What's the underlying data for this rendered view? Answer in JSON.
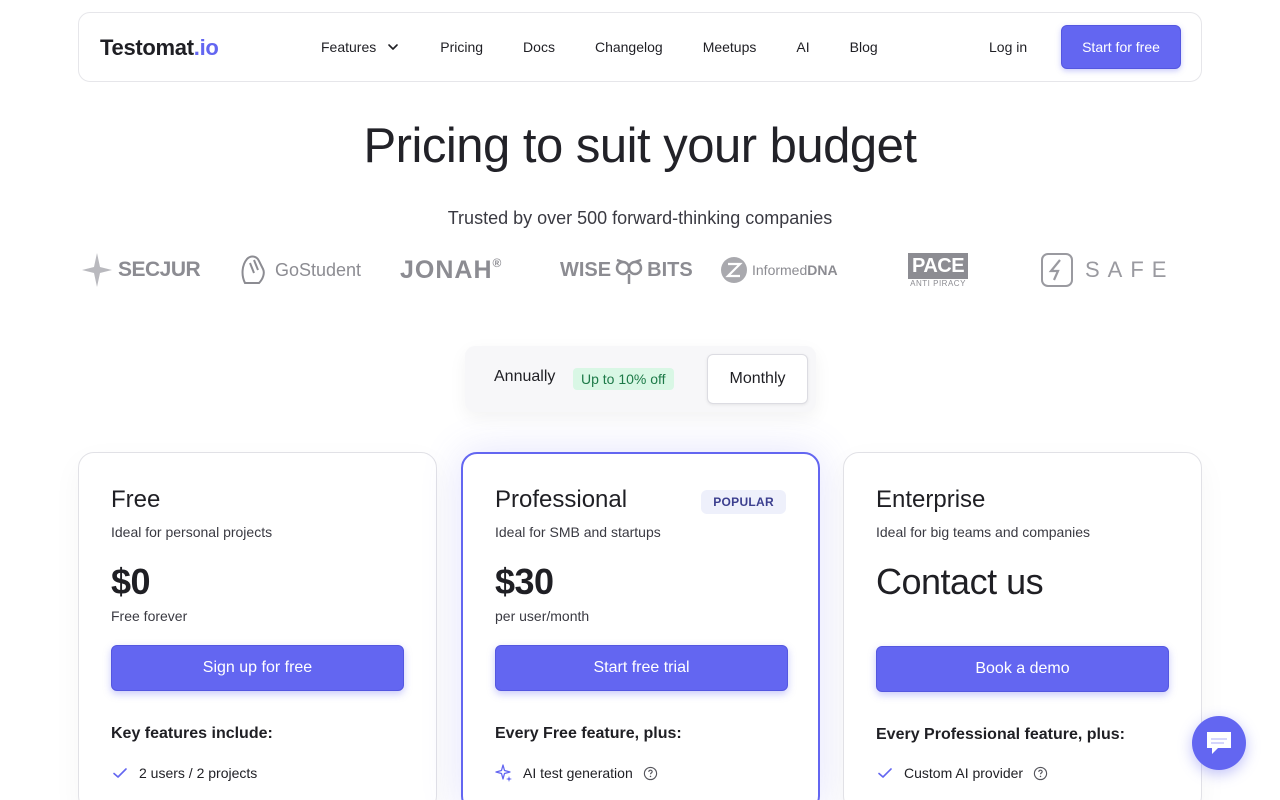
{
  "nav": {
    "logo_main": "Testomat",
    "logo_tld": ".io",
    "links": [
      {
        "label": "Features"
      },
      {
        "label": "Pricing"
      },
      {
        "label": "Docs"
      },
      {
        "label": "Changelog"
      },
      {
        "label": "Meetups"
      },
      {
        "label": "AI"
      },
      {
        "label": "Blog"
      }
    ],
    "login": "Log in",
    "cta": "Start for free"
  },
  "hero": {
    "title": "Pricing to suit your budget",
    "trusted": "Trusted by over 500 forward-thinking companies"
  },
  "brands": {
    "secjur": "SECJUR",
    "gostudent": "GoStudent",
    "jonah": "JONAH",
    "jonah_mark": "®",
    "wise": "WISE",
    "bits": "BITS",
    "informed": "Informed",
    "dna": "DNA",
    "pace": "PACE",
    "pace_sub": "ANTI PIRACY",
    "safe": "SAFE"
  },
  "billing": {
    "annual": "Annually",
    "discount": "Up to 10% off",
    "monthly": "Monthly"
  },
  "plans": [
    {
      "name": "Free",
      "desc": "Ideal for personal projects",
      "price": "$0",
      "note": "Free forever",
      "cta": "Sign up for free",
      "feat_head": "Key features include:",
      "feature": "2 users / 2 projects"
    },
    {
      "name": "Professional",
      "badge": "POPULAR",
      "desc": "Ideal for SMB and startups",
      "price": "$30",
      "note": "per user/month",
      "cta": "Start free trial",
      "feat_head": "Every Free feature, plus:",
      "feature": "AI test generation"
    },
    {
      "name": "Enterprise",
      "desc": "Ideal for big teams and companies",
      "price": "Contact us",
      "note": "",
      "cta": "Book a demo",
      "feat_head": "Every Professional feature, plus:",
      "feature": "Custom AI provider"
    }
  ],
  "colors": {
    "accent": "#6366f1",
    "discount_bg": "#d9f7e5",
    "discount_fg": "#1d7a48"
  }
}
